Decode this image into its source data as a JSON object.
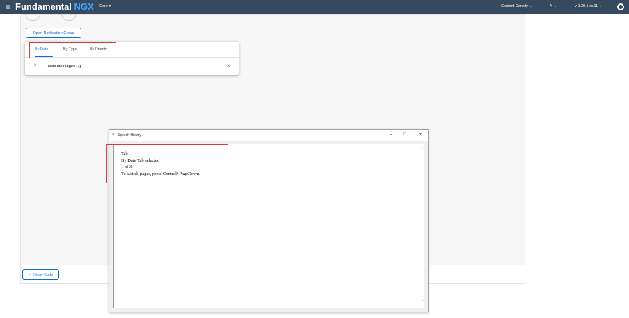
{
  "shellbar": {
    "menu_icon": "hamburger-icon",
    "brand_primary": "Fundamental",
    "brand_accent": "NGX",
    "product_menu": "Core ▾",
    "content_density": "Content Density",
    "theme_menu": "✎ ⌵",
    "version": "v 0.30.1-rc.11",
    "github_icon": "github-icon"
  },
  "main": {
    "open_button_label": "Open Notification Group",
    "show_code_label": "Show Code"
  },
  "notification_group": {
    "tabs": [
      {
        "label": "By Date",
        "selected": true
      },
      {
        "label": "By Type",
        "selected": false
      },
      {
        "label": "By Priority",
        "selected": false
      }
    ],
    "group_title": "New Messages (2)",
    "expand_icon": "chevron-right-icon",
    "close_icon": "close-icon"
  },
  "speech_history": {
    "title": "Speech History",
    "minimize": "–",
    "maximize": "□",
    "close": "✕",
    "lines": [
      "Tab",
      "By Date Tab selected",
      "1 of 3",
      "To switch pages, press Control+PageDown."
    ]
  },
  "colors": {
    "shellbar_bg": "#354a5f",
    "accent": "#0a6ed1",
    "highlight": "#d83c3c"
  }
}
